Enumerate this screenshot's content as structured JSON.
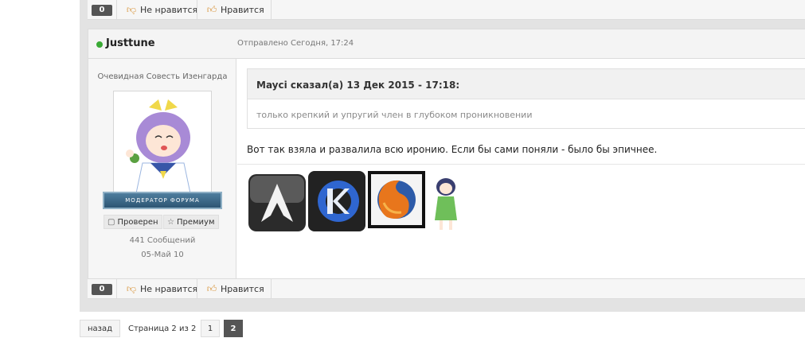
{
  "top_bar": {
    "count": "0",
    "dislike_label": "Не нравится",
    "like_label": "Нравится"
  },
  "post": {
    "author": "Justtune",
    "posted": "Отправлено Сегодня, 17:24",
    "profile": {
      "rank": "Очевидная Совесть Изенгарда",
      "moderator_badge": "МОДЕРАТОР ФОРУМА",
      "checked_label": "Проверен",
      "premium_label": "Премиум",
      "posts": "441 Сообщений",
      "joined": "05-Май 10"
    },
    "quote": {
      "author": "Mayci сказал(а) 13 Дек 2015 - 17:18:",
      "text": "только крепкий и упругий член в глубоком проникновении"
    },
    "text": "Вот так взяла и развалила всю иронию. Если бы сами поняли - было бы эпичнее.",
    "signature_icons": [
      "arch-linux-icon",
      "kde-icon",
      "firefox-icon",
      "anime-girl-icon"
    ]
  },
  "bottom_bar": {
    "count": "0",
    "dislike_label": "Не нравится",
    "like_label": "Нравится"
  },
  "pagination": {
    "back_label": "назад",
    "info": "Страница 2 из 2",
    "pages": [
      "1",
      "2"
    ],
    "current": "2"
  },
  "colors": {
    "online": "#3aaa35",
    "thumb": "#d9963e",
    "dark_badge": "#555555"
  }
}
